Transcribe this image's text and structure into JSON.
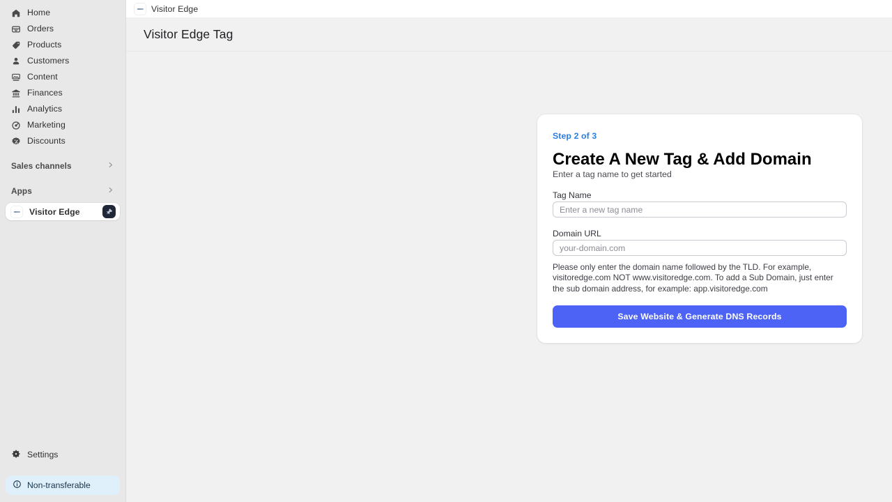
{
  "sidebar": {
    "nav_items": [
      {
        "label": "Home",
        "icon": "home-icon"
      },
      {
        "label": "Orders",
        "icon": "orders-icon"
      },
      {
        "label": "Products",
        "icon": "products-tag-icon"
      },
      {
        "label": "Customers",
        "icon": "customers-person-icon"
      },
      {
        "label": "Content",
        "icon": "content-image-icon"
      },
      {
        "label": "Finances",
        "icon": "finances-bank-icon"
      },
      {
        "label": "Analytics",
        "icon": "analytics-bars-icon"
      },
      {
        "label": "Marketing",
        "icon": "marketing-megaphone-icon"
      },
      {
        "label": "Discounts",
        "icon": "discounts-badge-icon"
      }
    ],
    "sections": [
      {
        "label": "Sales channels",
        "icon": "chevron-right-icon"
      },
      {
        "label": "Apps",
        "icon": "chevron-right-icon"
      }
    ],
    "app_item": {
      "label": "Visitor Edge",
      "logo": "visitor-edge-logo",
      "badge": "pin-icon"
    },
    "settings": {
      "label": "Settings",
      "icon": "gear-icon"
    },
    "status_badge": {
      "label": "Non-transferable",
      "icon": "info-circle-icon",
      "bg": "#e0f0fa",
      "color": "#17344b"
    }
  },
  "topbar": {
    "breadcrumb": "Visitor Edge",
    "logo": "visitor-edge-logo"
  },
  "page": {
    "title": "Visitor Edge Tag"
  },
  "card": {
    "step": "Step 2 of 3",
    "step_color": "#2b7de0",
    "heading": "Create A New Tag & Add Domain",
    "subheading": "Enter a tag name to get started",
    "fields": [
      {
        "label": "Tag Name",
        "value": "",
        "placeholder": "Enter a new tag name",
        "name": "tag-name"
      },
      {
        "label": "Domain URL",
        "value": "",
        "placeholder": "your-domain.com",
        "name": "domain-url"
      }
    ],
    "helper_text": "Please only enter the domain name followed by the TLD. For example, visitoredge.com NOT www.visitoredge.com. To add a Sub Domain, just enter the sub domain address, for example: app.visitoredge.com",
    "submit_label": "Save Website & Generate DNS Records",
    "submit_color": "#4c63f5"
  }
}
